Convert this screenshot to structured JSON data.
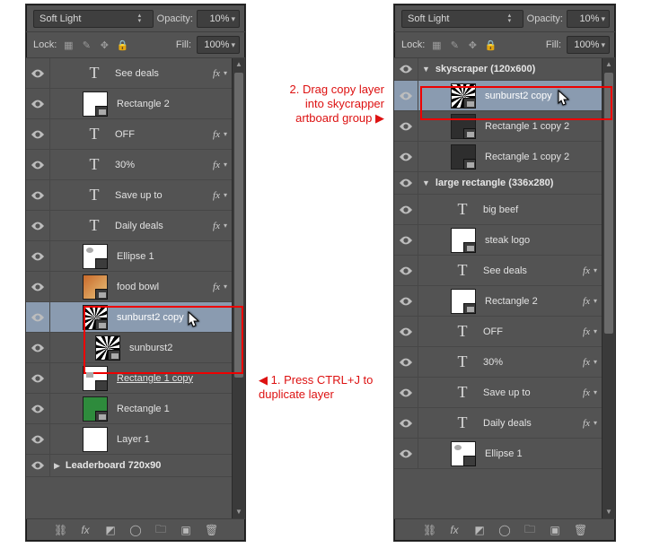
{
  "blend_mode": "Soft Light",
  "opacity_label": "Opacity:",
  "opacity_value": "10%",
  "lock_label": "Lock:",
  "fill_label": "Fill:",
  "fill_value": "100%",
  "annotations": {
    "step1": "1. Press CTRL+J to duplicate layer",
    "step2": "2. Drag copy layer into skycrapper artboard group"
  },
  "left_panel": {
    "layers": [
      {
        "kind": "text",
        "name": "See deals",
        "fx": true
      },
      {
        "kind": "shape",
        "name": "Rectangle 2",
        "fx": false,
        "thumb": "th-white smart"
      },
      {
        "kind": "text",
        "name": "OFF",
        "fx": true
      },
      {
        "kind": "text",
        "name": "30%",
        "fx": true
      },
      {
        "kind": "text",
        "name": "Save up to",
        "fx": true
      },
      {
        "kind": "text",
        "name": "Daily deals",
        "fx": true
      },
      {
        "kind": "shape",
        "name": "Ellipse 1",
        "fx": false,
        "thumb": "th-white smart th-dot"
      },
      {
        "kind": "shape",
        "name": "food bowl",
        "fx": true,
        "thumb": "th-food smart"
      },
      {
        "kind": "shape",
        "name": "sunburst2 copy",
        "fx": false,
        "thumb": "th-sun smart",
        "selected": true,
        "cursor": true
      },
      {
        "kind": "shape",
        "name": "sunburst2",
        "fx": false,
        "thumb": "th-sun smart"
      },
      {
        "kind": "shape",
        "name": "Rectangle 1 copy",
        "fx": false,
        "thumb": "th-white smart th-greenrect",
        "underline": true
      },
      {
        "kind": "shape",
        "name": "Rectangle 1",
        "fx": false,
        "thumb": "th-green smart"
      },
      {
        "kind": "shape",
        "name": "Layer 1",
        "fx": false,
        "thumb": "th-white"
      }
    ],
    "collapsed_group": "Leaderboard 720x90"
  },
  "right_panel": {
    "groups": [
      {
        "name": "skyscraper (120x600)",
        "open": true,
        "layers": [
          {
            "kind": "shape",
            "name": "sunburst2 copy",
            "thumb": "th-sun smart",
            "selected": true,
            "cursor": true
          },
          {
            "kind": "shape",
            "name": "Rectangle 1 copy 2",
            "thumb": "th-dark smart"
          },
          {
            "kind": "shape",
            "name": "Rectangle 1 copy 2",
            "thumb": "th-dark smart"
          }
        ]
      },
      {
        "name": "large rectangle (336x280)",
        "open": true,
        "layers": [
          {
            "kind": "text",
            "name": "big beef",
            "fx": false
          },
          {
            "kind": "shape",
            "name": "steak logo",
            "thumb": "th-white smart"
          },
          {
            "kind": "text",
            "name": "See deals",
            "fx": true
          },
          {
            "kind": "shape",
            "name": "Rectangle 2",
            "thumb": "th-white smart",
            "fx": true
          },
          {
            "kind": "text",
            "name": "OFF",
            "fx": true
          },
          {
            "kind": "text",
            "name": "30%",
            "fx": true
          },
          {
            "kind": "text",
            "name": "Save up to",
            "fx": true
          },
          {
            "kind": "text",
            "name": "Daily deals",
            "fx": true
          },
          {
            "kind": "shape",
            "name": "Ellipse 1",
            "thumb": "th-white smart th-dot"
          }
        ]
      }
    ]
  }
}
